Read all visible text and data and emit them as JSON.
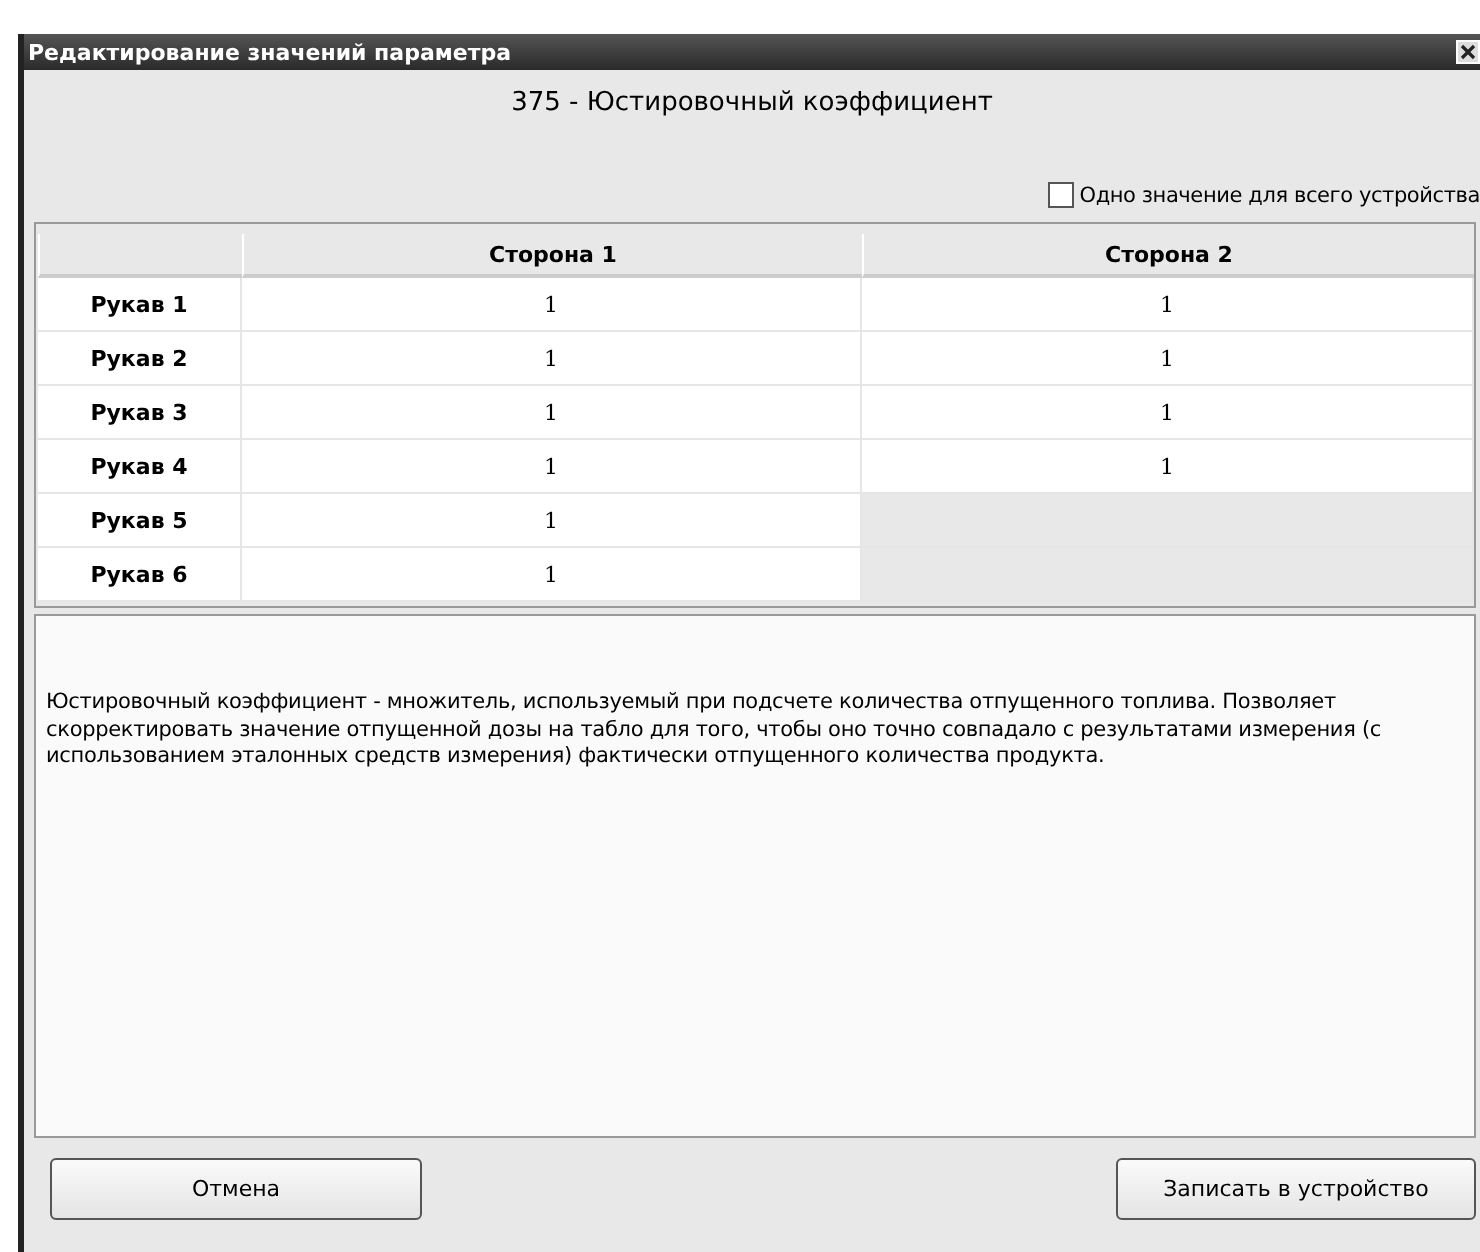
{
  "window": {
    "title": "Редактирование значений параметра"
  },
  "heading": "375 - Юстировочный коэффициент",
  "single_value": {
    "label": "Одно значение для всего устройства",
    "checked": false
  },
  "table": {
    "columns": [
      "Сторона 1",
      "Сторона 2"
    ],
    "rows": [
      {
        "label": "Рукав 1",
        "cells": [
          "1",
          "1"
        ]
      },
      {
        "label": "Рукав 2",
        "cells": [
          "1",
          "1"
        ]
      },
      {
        "label": "Рукав 3",
        "cells": [
          "1",
          "1"
        ]
      },
      {
        "label": "Рукав 4",
        "cells": [
          "1",
          "1"
        ]
      },
      {
        "label": "Рукав 5",
        "cells": [
          "1"
        ]
      },
      {
        "label": "Рукав 6",
        "cells": [
          "1"
        ]
      }
    ]
  },
  "description": "Юстировочный коэффициент - множитель, используемый при подсчете количества отпущенного топлива. Позволяет скорректировать значение отпущенной дозы на табло для того, чтобы оно точно совпадало с результатами измерения (с использованием эталонных средств измерения) фактически отпущенного количества продукта.",
  "buttons": {
    "cancel": "Отмена",
    "write": "Записать в устройство"
  }
}
